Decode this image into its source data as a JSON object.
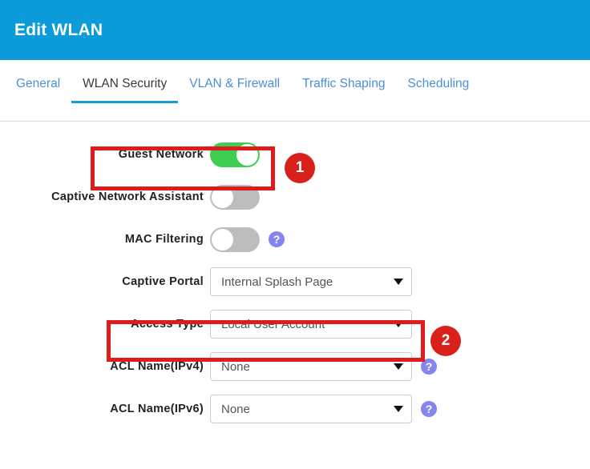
{
  "header": {
    "title": "Edit WLAN",
    "bg_color": "#0b9bd8"
  },
  "tabs": [
    {
      "label": "General",
      "active": false
    },
    {
      "label": "WLAN Security",
      "active": true
    },
    {
      "label": "VLAN & Firewall",
      "active": false
    },
    {
      "label": "Traffic Shaping",
      "active": false
    },
    {
      "label": "Scheduling",
      "active": false
    }
  ],
  "form": {
    "rows": [
      {
        "label": "Guest Network",
        "control": "toggle",
        "value": "on",
        "help": false
      },
      {
        "label": "Captive Network Assistant",
        "control": "toggle",
        "value": "off",
        "help": false
      },
      {
        "label": "MAC Filtering",
        "control": "toggle",
        "value": "off",
        "help": true
      },
      {
        "label": "Captive Portal",
        "control": "select",
        "value": "Internal Splash Page",
        "help": false
      },
      {
        "label": "Access Type",
        "control": "select",
        "value": "Local User Account",
        "help": false
      },
      {
        "label": "ACL Name(IPv4)",
        "control": "select",
        "value": "None",
        "help": true
      },
      {
        "label": "ACL Name(IPv6)",
        "control": "select",
        "value": "None",
        "help": true
      }
    ],
    "help_glyph": "?"
  },
  "annotations": {
    "highlight_color": "#e01b1b",
    "badge_color": "#d9211b",
    "callouts": [
      {
        "number": "1",
        "target": "Guest Network"
      },
      {
        "number": "2",
        "target": "Access Type"
      }
    ]
  }
}
